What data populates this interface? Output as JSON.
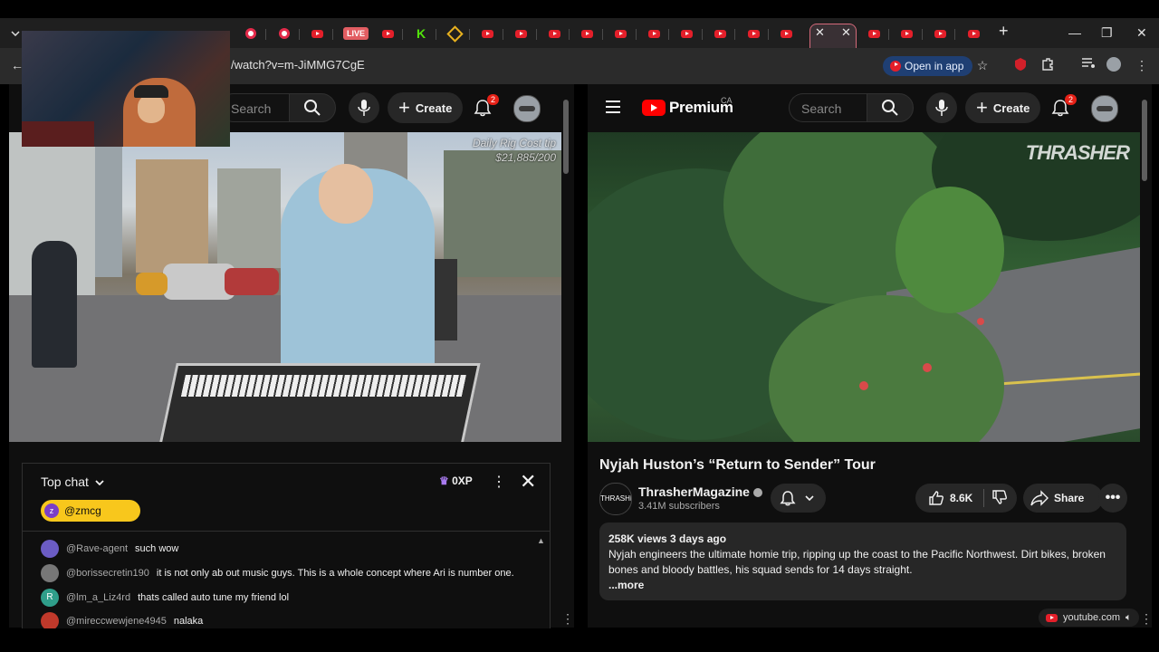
{
  "browser": {
    "live_badge": "LIVE",
    "tab_close": "✕",
    "new_tab": "+",
    "url": "/watch?v=m-JiMMG7CgE",
    "open_in_app": "Open in app"
  },
  "left": {
    "search_placeholder": "Search",
    "create_label": "Create",
    "notif_count": "2",
    "video_overlay_line1": "Daily Rig Cost tip",
    "video_overlay_line2": "$21,885/200",
    "chat": {
      "title": "Top chat",
      "xp": "0XP",
      "user_initial": "z",
      "user_handle": "@zmcg",
      "messages": [
        {
          "author": "@Rave-agent",
          "text": "such wow",
          "color": "#6b5cc4",
          "initial": ""
        },
        {
          "author": "@borissecretin190",
          "text": "it is not only ab out music guys. This is a whole concept where Ari is number one.",
          "color": "#777777",
          "initial": ""
        },
        {
          "author": "@lm_a_Liz4rd",
          "text": "thats called auto tune my friend lol",
          "color": "#2f9e8a",
          "initial": "R"
        },
        {
          "author": "@mireccwewjene4945",
          "text": "nalaka",
          "color": "#c0392b",
          "initial": ""
        }
      ]
    }
  },
  "right": {
    "logo_text": "Premium",
    "country": "CA",
    "search_placeholder": "Search",
    "create_label": "Create",
    "notif_count": "2",
    "watermark": "THRASHER",
    "video_title": "Nyjah Huston’s “Return to Sender” Tour",
    "channel_name": "ThrasherMagazine",
    "channel_subs": "3.41M subscribers",
    "likes": "8.6K",
    "share_label": "Share",
    "desc_stats": "258K views  3 days ago",
    "desc_text": "Nyjah engineers the ultimate homie trip, ripping up the coast to the Pacific Northwest. Dirt bikes, broken bones and bloody battles, his squad sends for 14 days straight.",
    "desc_more": "...more",
    "channel_avatar_text": "THRASHER"
  },
  "statusbar": {
    "domain": "youtube.com"
  },
  "colors": {
    "youtube_red": "#ff0000",
    "chrome_tabstrip": "#1f1f1f",
    "chrome_toolbar": "#2b2b2b",
    "yt_bg": "#0f0f0f",
    "highlight_pill": "#f8c71c",
    "open_in_app_bg": "#1f3f73"
  }
}
